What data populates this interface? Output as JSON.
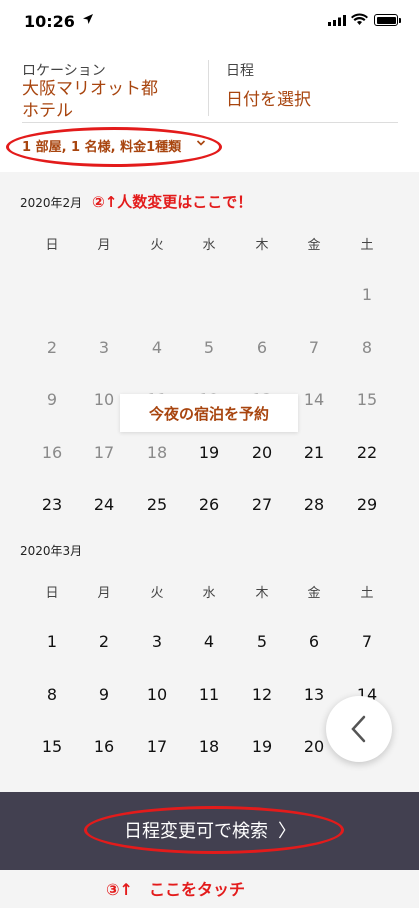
{
  "status_bar": {
    "time": "10:26"
  },
  "header": {
    "location_label": "ロケーション",
    "location_value_line1": "大阪マリオット都",
    "location_value_line2": "ホテル",
    "dates_label": "日程",
    "dates_value": "日付を選択",
    "guests": "1 部屋, 1 名様, 料金1種類"
  },
  "calendar": {
    "weekdays": [
      "日",
      "月",
      "火",
      "水",
      "木",
      "金",
      "土"
    ],
    "tonight_button": "今夜の宿泊を予約",
    "months": [
      {
        "title": "2020年2月",
        "note": "②↑人数変更はここで！",
        "weeks": [
          [
            "",
            "",
            "",
            "",
            "",
            "",
            "1"
          ],
          [
            "2",
            "3",
            "4",
            "5",
            "6",
            "7",
            "8"
          ],
          [
            "9",
            "10",
            "11",
            "12",
            "13",
            "14",
            "15"
          ],
          [
            "16",
            "17",
            "18",
            "19",
            "20",
            "21",
            "22"
          ],
          [
            "23",
            "24",
            "25",
            "26",
            "27",
            "28",
            "29"
          ]
        ]
      },
      {
        "title": "2020年3月",
        "weeks": [
          [
            "1",
            "2",
            "3",
            "4",
            "5",
            "6",
            "7"
          ],
          [
            "8",
            "9",
            "10",
            "11",
            "12",
            "13",
            "14"
          ],
          [
            "15",
            "16",
            "17",
            "18",
            "19",
            "20",
            "21"
          ]
        ]
      }
    ]
  },
  "bottom_bar": {
    "search_label": "日程変更可で検索",
    "search_chevron": "〉"
  },
  "footer": {
    "note": "③↑　ここをタッチ"
  },
  "colors": {
    "accent": "#a8450f",
    "annotation": "#e31b1b",
    "bar": "#424050"
  }
}
